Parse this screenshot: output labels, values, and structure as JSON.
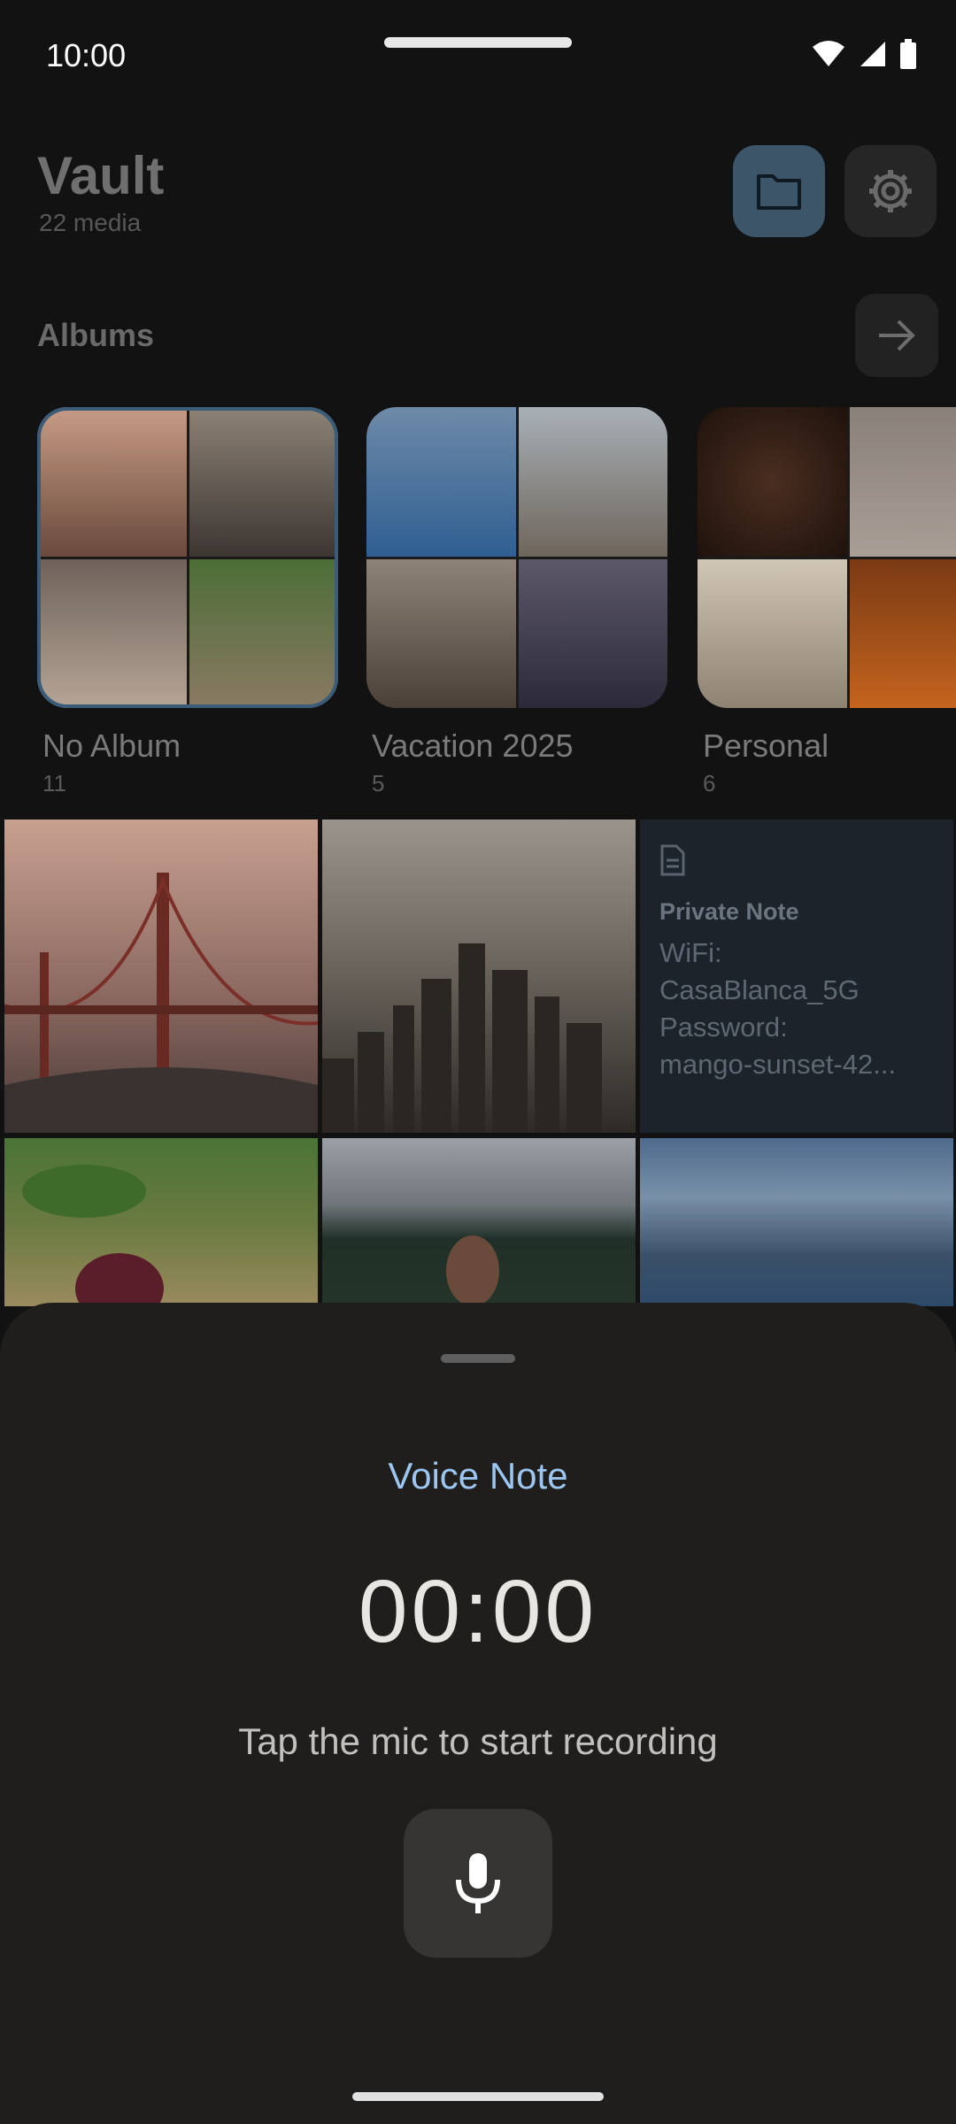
{
  "status_bar": {
    "time": "10:00"
  },
  "header": {
    "title": "Vault",
    "subtitle": "22 media"
  },
  "albums_section": {
    "label": "Albums"
  },
  "albums": [
    {
      "name": "No Album",
      "count": "11",
      "tiles": [
        "#b98f7a",
        "#55504c",
        "#8d7f75",
        "#5e7a4a"
      ]
    },
    {
      "name": "Vacation 2025",
      "count": "5",
      "tiles": [
        "#3f6f9a",
        "#9ea6ac",
        "#7d746a",
        "#3c3a4a"
      ]
    },
    {
      "name": "Personal",
      "count": "6",
      "tiles": [
        "#3a2418",
        "#9a8e86",
        "#c4b9a8",
        "#b45a22"
      ]
    }
  ],
  "media_grid": {
    "photos_row1": [
      {
        "id": "golden-gate",
        "color_top": "#c99d86",
        "color_bottom": "#5c3c34"
      },
      {
        "id": "city-skyline",
        "color_top": "#8a857f",
        "color_bottom": "#3b3733"
      }
    ],
    "note": {
      "title": "Private Note",
      "body": "WiFi:\nCasaBlanca_5G\nPassword:\nmango-sunset-42..."
    },
    "photos_row2": [
      {
        "id": "food",
        "color_top": "#4f7a38",
        "color_bottom": "#7a5c40"
      },
      {
        "id": "lake-woman",
        "color_top": "#8a9098",
        "color_bottom": "#2b3b33"
      },
      {
        "id": "fjord",
        "color_top": "#5a7aa0",
        "color_bottom": "#3c4f68"
      }
    ]
  },
  "voice_sheet": {
    "title": "Voice Note",
    "timer": "00:00",
    "hint": "Tap the mic to start recording"
  },
  "colors": {
    "accent": "#9cc6f0",
    "sheet_bg": "#1f1e1c",
    "selected_outline": "#3b5c78"
  }
}
